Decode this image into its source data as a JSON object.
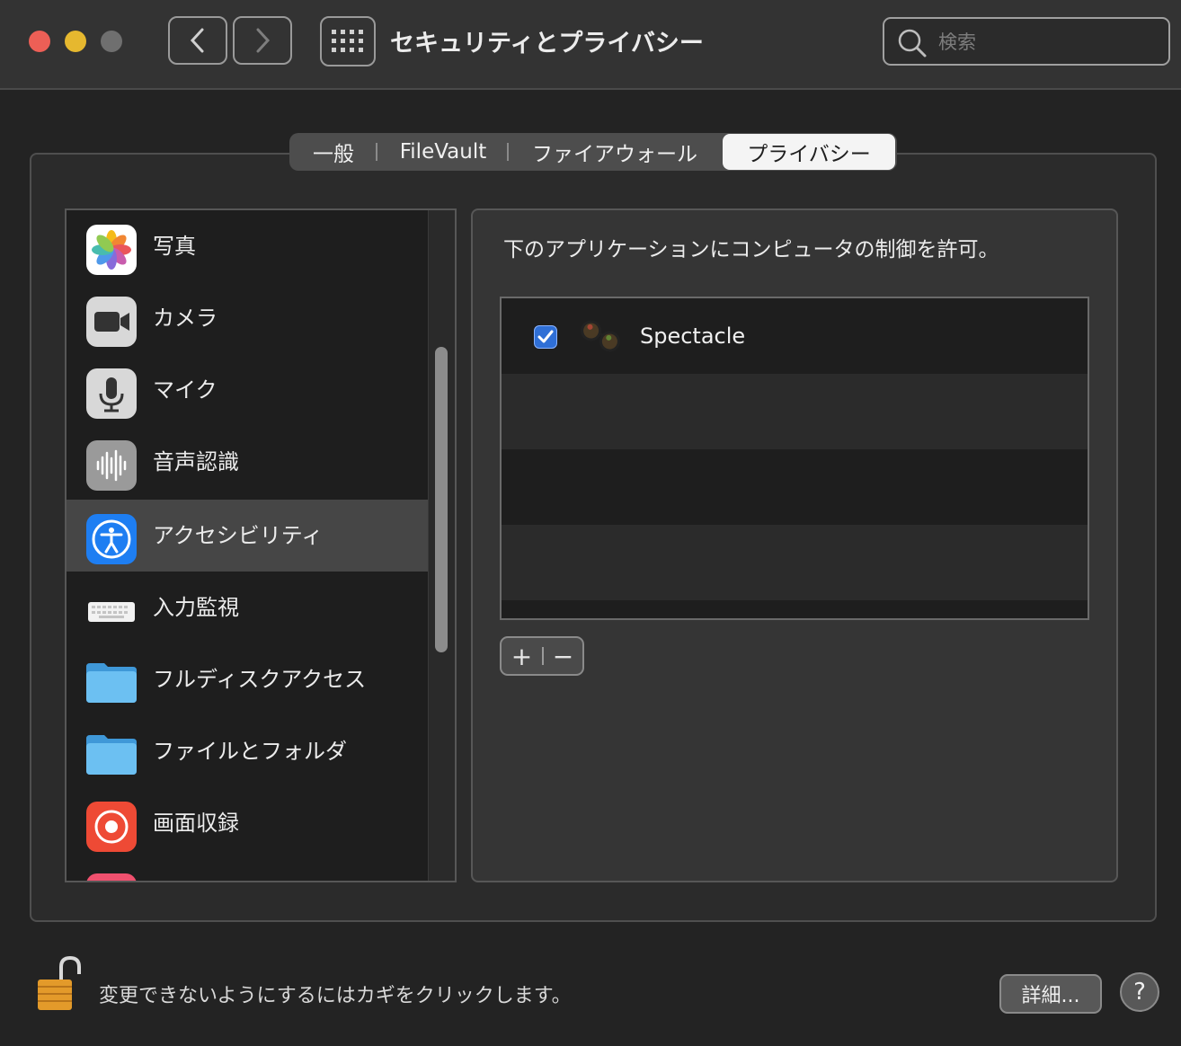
{
  "window": {
    "title": "セキュリティとプライバシー",
    "traffic_lights": {
      "close": "#ed5f56",
      "minimize": "#e6b82f",
      "zoom": "#6f6f6f"
    }
  },
  "search": {
    "placeholder": "検索",
    "value": ""
  },
  "tabs": [
    {
      "label": "一般",
      "selected": false
    },
    {
      "label": "FileVault",
      "selected": false
    },
    {
      "label": "ファイアウォール",
      "selected": false
    },
    {
      "label": "プライバシー",
      "selected": true
    }
  ],
  "sidebar": {
    "items": [
      {
        "label": "写真",
        "icon": "photos-icon"
      },
      {
        "label": "カメラ",
        "icon": "camera-icon"
      },
      {
        "label": "マイク",
        "icon": "microphone-icon"
      },
      {
        "label": "音声認識",
        "icon": "speech-recognition-icon"
      },
      {
        "label": "アクセシビリティ",
        "icon": "accessibility-icon",
        "selected": true
      },
      {
        "label": "入力監視",
        "icon": "keyboard-icon"
      },
      {
        "label": "フルディスクアクセス",
        "icon": "folder-icon"
      },
      {
        "label": "ファイルとフォルダ",
        "icon": "folder-icon"
      },
      {
        "label": "画面収録",
        "icon": "screen-recording-icon"
      }
    ]
  },
  "main": {
    "description": "下のアプリケーションにコンピュータの制御を許可。",
    "apps": [
      {
        "name": "Spectacle",
        "checked": true,
        "icon": "spectacle-app-icon"
      }
    ],
    "add_symbol": "+",
    "remove_symbol": "−"
  },
  "footer": {
    "lock_message": "変更できないようにするにはカギをクリックします。",
    "advanced_label": "詳細...",
    "help_label": "?"
  },
  "colors": {
    "accent": "#2f6fd6",
    "selected_row": "#464646"
  }
}
